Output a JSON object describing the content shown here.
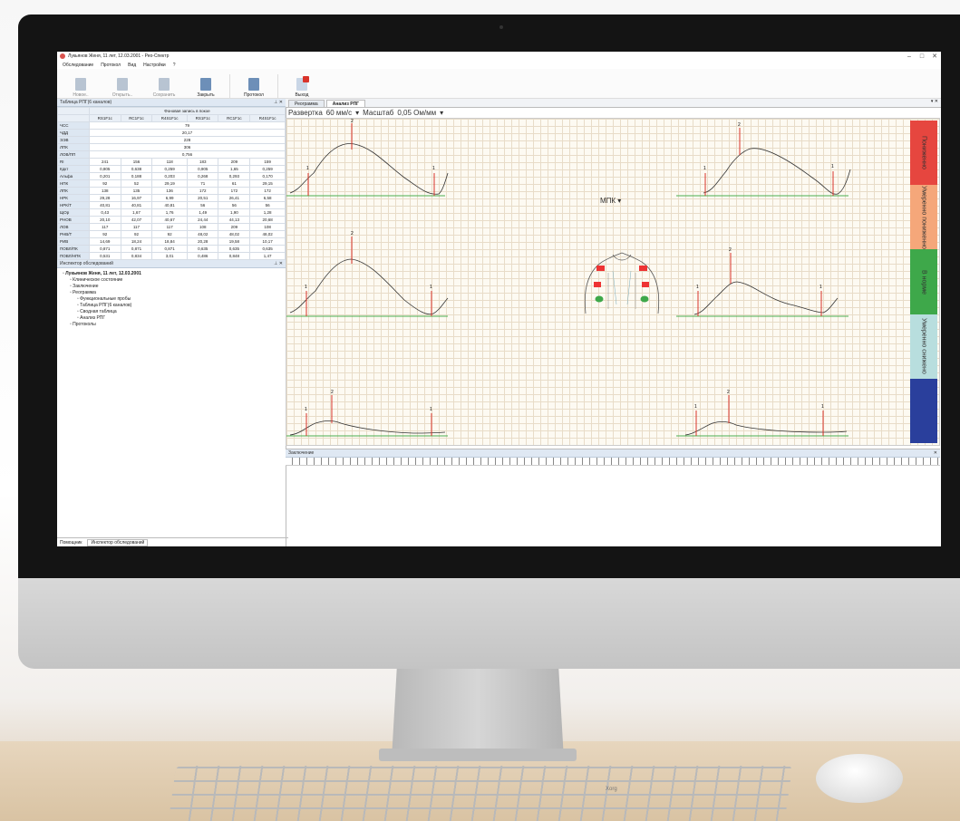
{
  "window": {
    "title": "Лукьянов Женя, 11 лет, 12.03.2001 - Рео-Спектр",
    "controls": [
      "–",
      "□",
      "✕"
    ]
  },
  "menu": [
    "Обследование",
    "Протокол",
    "Вид",
    "Настройки",
    "?"
  ],
  "toolbar": [
    {
      "label": "Новое..",
      "icon": "new-exam-icon",
      "enabled": false
    },
    {
      "label": "Открыть..",
      "icon": "open-icon",
      "enabled": false
    },
    {
      "label": "Сохранить",
      "icon": "save-icon",
      "enabled": false
    },
    {
      "label": "Закрыть",
      "icon": "close-exam-icon",
      "enabled": true
    },
    {
      "label": "Протокол",
      "icon": "protocol-icon",
      "enabled": true
    },
    {
      "label": "Выход",
      "icon": "exit-icon",
      "enabled": true
    }
  ],
  "rpg_table": {
    "title": "Таблица РПГ(6 каналов)",
    "group_header": "Фоновая запись в покое",
    "columns": [
      "RS1F1c",
      "RC1F1c",
      "R4S1F1c",
      "RS1F1c",
      "RC1F1c",
      "R4S1F1c"
    ],
    "span_rows": [
      {
        "label": "ЧСС",
        "value": "79"
      },
      {
        "label": "ЧДД",
        "value": "20,17"
      },
      {
        "label": "ЭЭВ",
        "value": "228"
      },
      {
        "label": "ЛПК",
        "value": "306"
      },
      {
        "label": "ЛОВ/ПП",
        "value": "0,756"
      }
    ],
    "rows": [
      {
        "label": "RI",
        "cells": [
          "241",
          "156",
          "118",
          "183",
          "209",
          "159"
        ]
      },
      {
        "label": "Кдкт",
        "cells": [
          "0,805",
          "0,638",
          "0,259",
          "0,905",
          "1,65",
          "0,259"
        ]
      },
      {
        "label": "Альфа",
        "cells": [
          "0,201",
          "0,188",
          "0,203",
          "0,268",
          "0,293",
          "0,170"
        ]
      },
      {
        "label": "НПК",
        "cells": [
          "92",
          "52",
          "29,19",
          "71",
          "61",
          "29,15"
        ]
      },
      {
        "label": "ЛПК",
        "cells": [
          "138",
          "135",
          "136",
          "172",
          "172",
          "172"
        ]
      },
      {
        "label": "НРК",
        "cells": [
          "29,28",
          "16,97",
          "6,99",
          "20,51",
          "26,41",
          "6,58"
        ]
      },
      {
        "label": "НРК/Т",
        "cells": [
          "40,81",
          "40,81",
          "40,81",
          "56",
          "56",
          "56"
        ]
      },
      {
        "label": "ЩОр",
        "cells": [
          "0,43",
          "1,67",
          "1,76",
          "1,49",
          "1,90",
          "1,28"
        ]
      },
      {
        "label": "РНОВ",
        "cells": [
          "20,10",
          "42,07",
          "40,67",
          "24,44",
          "44,13",
          "20,68"
        ]
      },
      {
        "label": "ЛОВ",
        "cells": [
          "117",
          "117",
          "117",
          "108",
          "209",
          "108"
        ]
      },
      {
        "label": "РНВ/Т",
        "cells": [
          "92",
          "92",
          "92",
          "48,02",
          "48,02",
          "48,02"
        ]
      },
      {
        "label": "РИВ",
        "cells": [
          "14,69",
          "18,24",
          "18,84",
          "20,28",
          "19,58",
          "10,17"
        ]
      },
      {
        "label": "ПОВЛ/ПК",
        "cells": [
          "0,871",
          "0,871",
          "0,871",
          "0,635",
          "0,635",
          "0,635"
        ]
      },
      {
        "label": "ПОВЛ/НПК",
        "cells": [
          "0,531",
          "0,834",
          "3,01",
          "0,486",
          "0,848",
          "1,47"
        ]
      }
    ]
  },
  "inspector": {
    "title": "Инспектор обследований",
    "tree": [
      {
        "label": "Лукьянов Женя, 11 лет, 12.03.2001",
        "level": 0,
        "bold": true
      },
      {
        "label": "Клиническое состояние",
        "level": 1
      },
      {
        "label": "Заключение",
        "level": 1
      },
      {
        "label": "Реограмма",
        "level": 1
      },
      {
        "label": "Функциональные пробы",
        "level": 2
      },
      {
        "label": "Таблица РПГ(6 каналов)",
        "level": 2
      },
      {
        "label": "Сводная таблица",
        "level": 2
      },
      {
        "label": "Анализ РПГ",
        "level": 2
      },
      {
        "label": "Протоколы",
        "level": 1
      }
    ]
  },
  "bottom_tabs": [
    "Помощник",
    "Инспектор обследований"
  ],
  "doc_tabs": [
    "Реограмма",
    "Анализ РПГ"
  ],
  "rpg_toolbar": {
    "sweep_label": "Развертка",
    "sweep_value": "60 мм/с",
    "scale_label": "Масштаб",
    "scale_value": "0,05 Ом/мм"
  },
  "mpk_label": "МПК",
  "legend": [
    {
      "label": "Пониженно",
      "color": "#e6463f"
    },
    {
      "label": "Умеренно пониженно",
      "color": "#f5a77a"
    },
    {
      "label": "В норме",
      "color": "#3ea84a"
    },
    {
      "label": "Умеренно снижено",
      "color": "#b8dede"
    },
    {
      "label": "",
      "color": "#2a3f9c"
    }
  ],
  "conclusion": {
    "title": "Заключение"
  },
  "keyboard_brand": "Xorg"
}
